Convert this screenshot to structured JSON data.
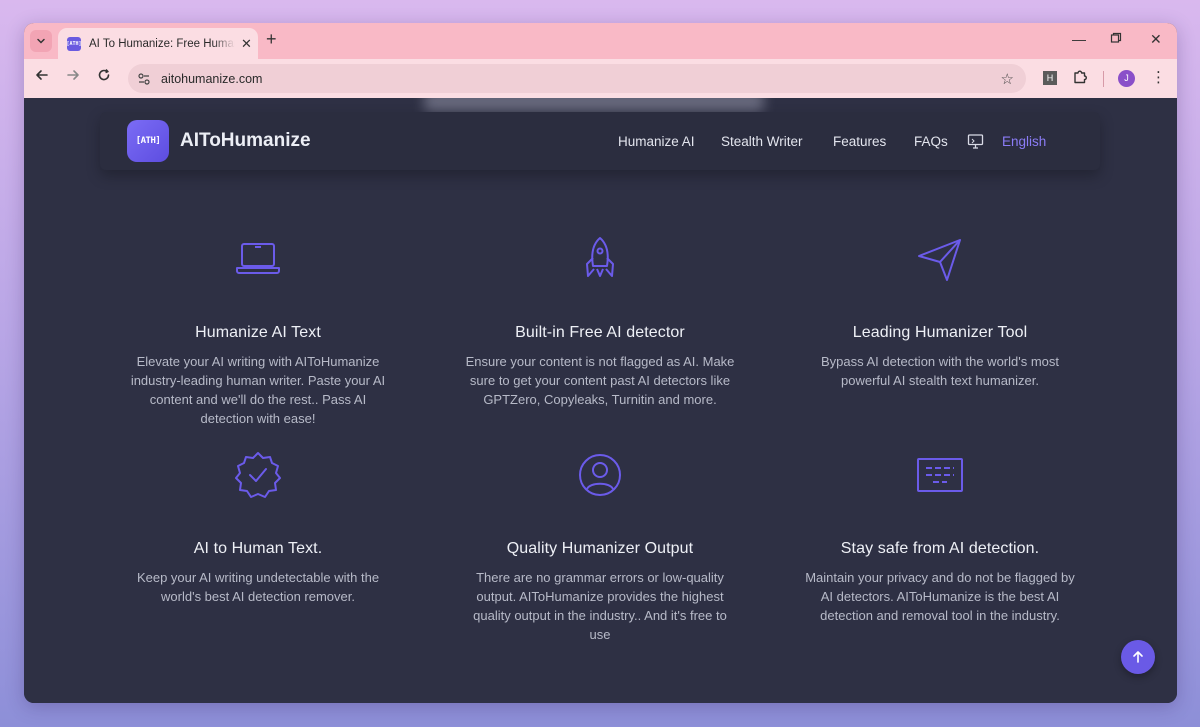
{
  "browser": {
    "tab_title": "AI To Humanize: Free Humanize AI",
    "tab_favicon_text": "[ATH]",
    "url": "aitohumanize.com",
    "ext_h_label": "H",
    "profile_initial": "J",
    "accent": "#f9b9c6"
  },
  "site": {
    "logo_text": "[ATH]",
    "brand": "AIToHumanize",
    "nav": [
      {
        "label": "Humanize AI"
      },
      {
        "label": "Stealth Writer"
      },
      {
        "label": "Features"
      },
      {
        "label": "FAQs"
      },
      {
        "label": "English"
      }
    ],
    "accent": "#6a5ae6"
  },
  "features": [
    {
      "icon": "laptop-icon",
      "title": "Humanize AI Text",
      "description": "Elevate your AI writing with AIToHumanize industry-leading human writer. Paste your AI content and we'll do the rest.. Pass AI detection with ease!"
    },
    {
      "icon": "rocket-icon",
      "title": "Built-in Free AI detector",
      "description": "Ensure your content is not flagged as AI. Make sure to get your content past AI detectors like GPTZero, Copyleaks, Turnitin and more."
    },
    {
      "icon": "paper-plane-icon",
      "title": "Leading Humanizer Tool",
      "description": "Bypass AI detection with the world's most powerful AI stealth text humanizer."
    },
    {
      "icon": "badge-check-icon",
      "title": "AI to Human Text.",
      "description": "Keep your AI writing undetectable with the world's best AI detection remover."
    },
    {
      "icon": "user-circle-icon",
      "title": "Quality Humanizer Output",
      "description": "There are no grammar errors or low-quality output. AIToHumanize provides the highest quality output in the industry.. And it's free to use"
    },
    {
      "icon": "document-text-icon",
      "title": "Stay safe from AI detection.",
      "description": "Maintain your privacy and do not be flagged by AI detectors. AIToHumanize is the best AI detection and removal tool in the industry."
    }
  ]
}
